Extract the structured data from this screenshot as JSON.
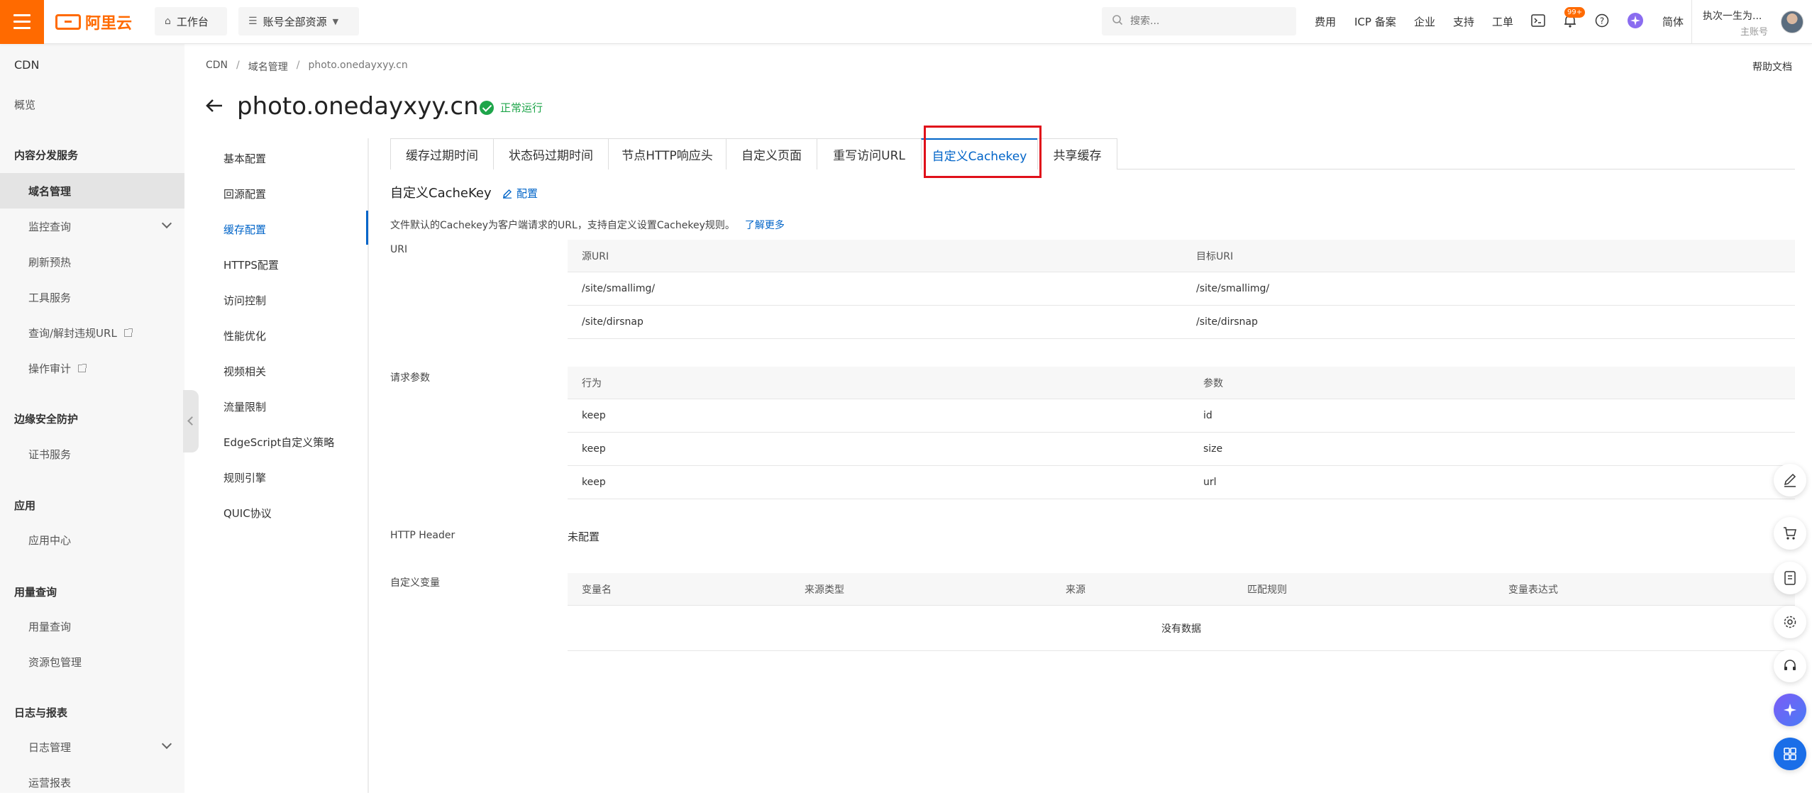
{
  "topbar": {
    "logo_text": "阿里云",
    "workbench_label": "工作台",
    "resource_label": "账号全部资源",
    "search_placeholder": "搜索...",
    "nav": [
      "费用",
      "ICP 备案",
      "企业",
      "支持",
      "工单"
    ],
    "bell_badge": "99+",
    "lang_label": "简体",
    "user_name": "执次一生为...",
    "user_role": "主账号",
    "brand_color": "#ff6a00"
  },
  "sidebar": {
    "title": "CDN",
    "overview": "概览",
    "groups": [
      {
        "title": "内容分发服务",
        "items": [
          "域名管理",
          "监控查询",
          "刷新预热",
          "工具服务",
          "查询/解封违规URL",
          "操作审计"
        ]
      },
      {
        "title": "边缘安全防护",
        "items": [
          "证书服务"
        ]
      },
      {
        "title": "应用",
        "items": [
          "应用中心"
        ]
      },
      {
        "title": "用量查询",
        "items": [
          "用量查询",
          "资源包管理"
        ]
      },
      {
        "title": "日志与报表",
        "items": [
          "日志管理",
          "运营报表"
        ]
      }
    ],
    "active_item": "域名管理"
  },
  "breadcrumb": [
    "CDN",
    "域名管理",
    "photo.onedayxyy.cn"
  ],
  "help_doc": "帮助文档",
  "page_title": "photo.onedayxyy.cn",
  "status_text": "正常运行",
  "status_color": "#1ea54a",
  "subnav": [
    "基本配置",
    "回源配置",
    "缓存配置",
    "HTTPS配置",
    "访问控制",
    "性能优化",
    "视频相关",
    "流量限制",
    "EdgeScript自定义策略",
    "规则引擎",
    "QUIC协议"
  ],
  "subnav_active": "缓存配置",
  "tabs": [
    "缓存过期时间",
    "状态码过期时间",
    "节点HTTP响应头",
    "自定义页面",
    "重写访问URL",
    "自定义Cachekey",
    "共享缓存"
  ],
  "active_tab": "自定义Cachekey",
  "accent_color": "#0064c8",
  "section": {
    "title": "自定义CacheKey",
    "config_label": "配置",
    "description": "文件默认的Cachekey为客户端请求的URL，支持自定义设置Cachekey规则。",
    "learn_more": "了解更多"
  },
  "uri": {
    "label": "URI",
    "headers": [
      "源URI",
      "目标URI"
    ],
    "rows": [
      [
        "/site/smallimg/",
        "/site/smallimg/"
      ],
      [
        "/site/dirsnap",
        "/site/dirsnap"
      ]
    ]
  },
  "params": {
    "label": "请求参数",
    "headers": [
      "行为",
      "参数"
    ],
    "rows": [
      [
        "keep",
        "id"
      ],
      [
        "keep",
        "size"
      ],
      [
        "keep",
        "url"
      ]
    ]
  },
  "http_header": {
    "label": "HTTP Header",
    "value": "未配置"
  },
  "custom_vars": {
    "label": "自定义变量",
    "headers": [
      "变量名",
      "来源类型",
      "来源",
      "匹配规则",
      "变量表达式"
    ],
    "empty_text": "没有数据"
  },
  "float_tools": [
    "edit-icon",
    "cart-icon",
    "document-icon",
    "gear-icon",
    "headset-icon",
    "ai-assistant-icon",
    "grid-icon"
  ]
}
